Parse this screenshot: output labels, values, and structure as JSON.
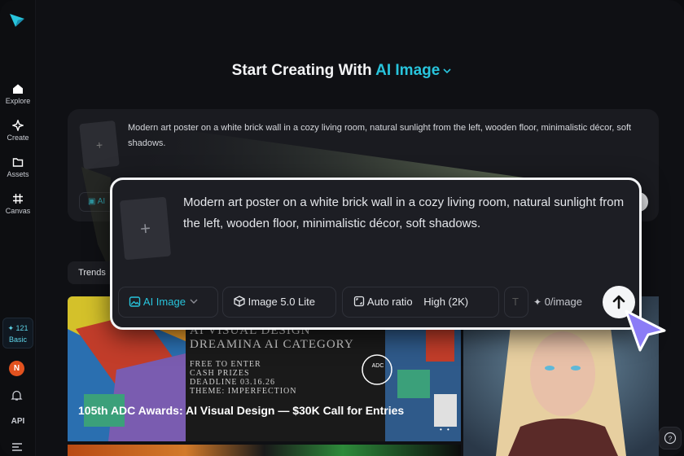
{
  "sidebar": {
    "items": [
      {
        "label": "Explore",
        "icon": "home-icon"
      },
      {
        "label": "Create",
        "icon": "sparkle-icon"
      },
      {
        "label": "Assets",
        "icon": "folder-icon"
      },
      {
        "label": "Canvas",
        "icon": "hash-icon"
      }
    ],
    "credits": "121",
    "plan": "Basic",
    "avatar_initial": "N",
    "api_label": "API"
  },
  "heading": {
    "prefix": "Start Creating With",
    "mode": "AI Image"
  },
  "prompt": {
    "text": "Modern art poster on a white brick wall in a cozy living room, natural sunlight from the left, wooden floor, minimalistic décor, soft shadows.",
    "thumb_placeholder": "+",
    "mode_chip": "AI Image",
    "model_chip": "Image 5.0 Lite",
    "ratio_label": "Auto ratio",
    "quality_label": "High (2K)",
    "cost": "0/image",
    "bg_mode_chip": "AI"
  },
  "tabs": [
    {
      "label": "Trends"
    }
  ],
  "gallery": {
    "featured_title": "105th ADC Awards: AI Visual Design — $30K Call for Entries",
    "poster_lines": [
      "AI VISUAL DESIGN",
      "DREAMINA AI CATEGORY",
      "FREE TO ENTER",
      "CASH PRIZES",
      "DEADLINE 03.16.26",
      "THEME: IMPERFECTION"
    ],
    "badge": "ADC"
  },
  "colors": {
    "accent": "#28c4dc",
    "background": "#0f1014",
    "card": "#1d1e24",
    "cursor": "#8b7cf6"
  }
}
